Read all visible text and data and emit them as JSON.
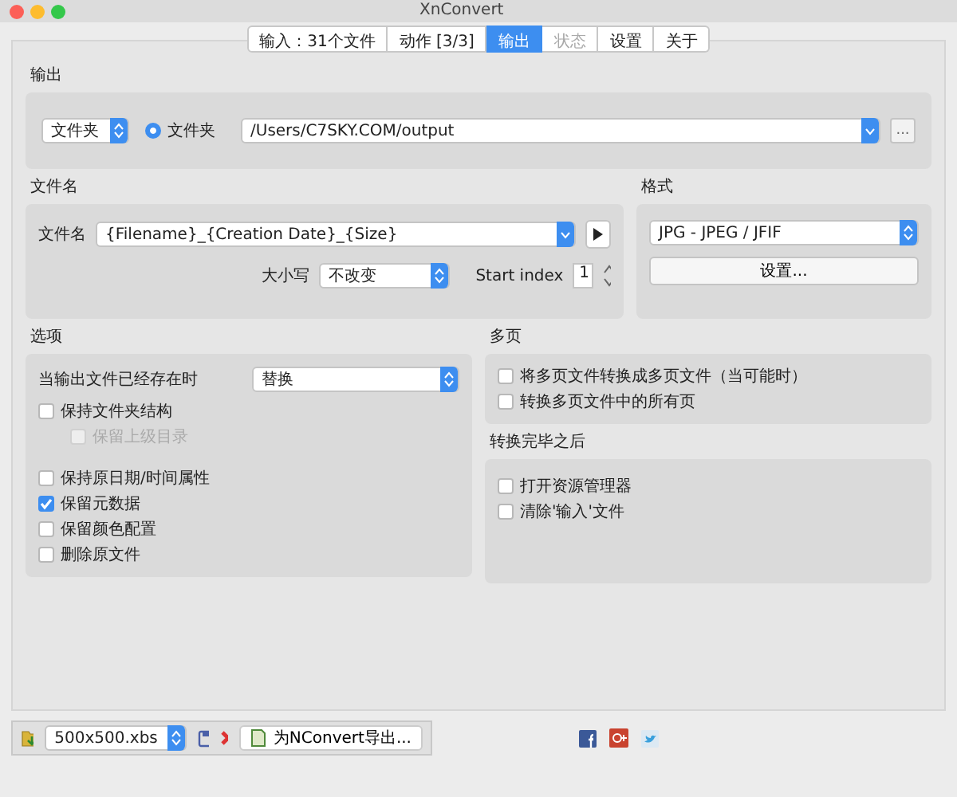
{
  "window": {
    "title": "XnConvert"
  },
  "tabs": [
    {
      "label": "输入：31个文件",
      "selected": false,
      "disabled": false
    },
    {
      "label": "动作 [3/3]",
      "selected": false,
      "disabled": false
    },
    {
      "label": "输出",
      "selected": true,
      "disabled": false
    },
    {
      "label": "状态",
      "selected": false,
      "disabled": true
    },
    {
      "label": "设置",
      "selected": false,
      "disabled": false
    },
    {
      "label": "关于",
      "selected": false,
      "disabled": false
    }
  ],
  "output": {
    "title": "输出",
    "type_select": "文件夹",
    "radio": {
      "label": "文件夹",
      "selected": true
    },
    "path": "/Users/C7SKY.COM/output",
    "browse_button": "..."
  },
  "filename": {
    "title": "文件名",
    "label": "文件名",
    "pattern": "{Filename}_{Creation Date}_{Size}",
    "case_label": "大小写",
    "case_value": "不改变",
    "start_index_label": "Start index",
    "start_index": "1"
  },
  "format": {
    "title": "格式",
    "value": "JPG - JPEG / JFIF",
    "settings_button": "设置..."
  },
  "options": {
    "title": "选项",
    "exists_label": "当输出文件已经存在时",
    "exists_value": "替换",
    "checkboxes": [
      {
        "label": "保持文件夹结构",
        "checked": false,
        "disabled": false,
        "children": [
          {
            "label": "保留上级目录",
            "checked": false,
            "disabled": true
          }
        ]
      },
      {
        "label": "保持原日期/时间属性",
        "checked": false,
        "disabled": false
      },
      {
        "label": "保留元数据",
        "checked": true,
        "disabled": false
      },
      {
        "label": "保留颜色配置",
        "checked": false,
        "disabled": false
      },
      {
        "label": "删除原文件",
        "checked": false,
        "disabled": false
      }
    ]
  },
  "multipage": {
    "title": "多页",
    "checkboxes": [
      {
        "label": "将多页文件转换成多页文件（当可能时）",
        "checked": false,
        "disabled": false
      },
      {
        "label": "转换多页文件中的所有页",
        "checked": false,
        "disabled": false
      }
    ]
  },
  "after": {
    "title": "转换完毕之后",
    "checkboxes": [
      {
        "label": "打开资源管理器",
        "checked": false,
        "disabled": false
      },
      {
        "label": "清除'输入'文件",
        "checked": false,
        "disabled": false
      }
    ]
  },
  "bottom": {
    "preset": "500x500.xbs",
    "export_button": "为NConvert导出..."
  }
}
